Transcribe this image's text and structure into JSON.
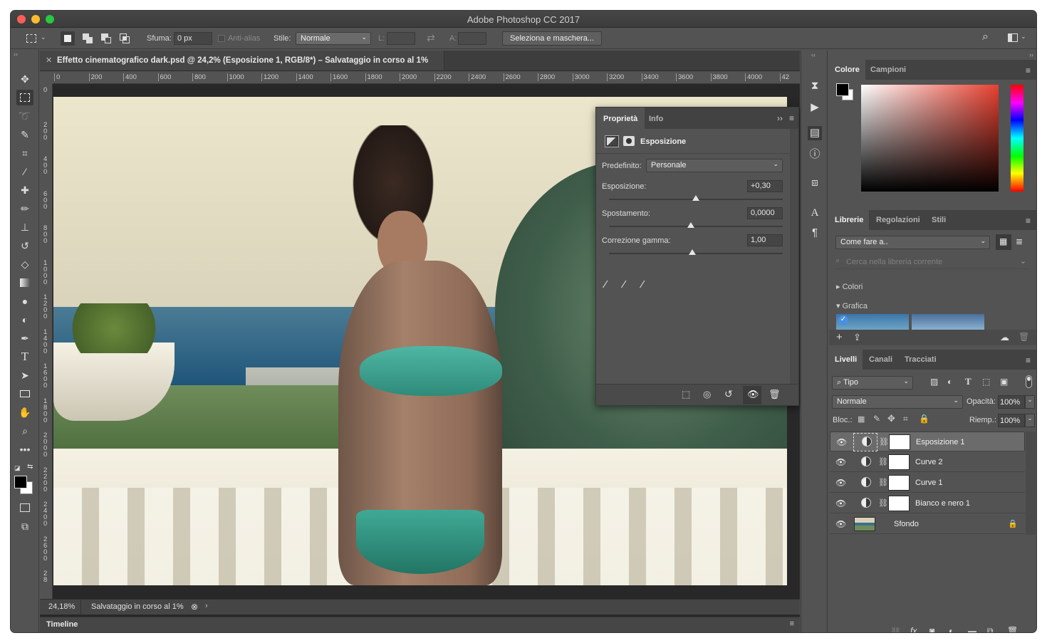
{
  "window": {
    "title": "Adobe Photoshop CC 2017",
    "traffic_colors": [
      "#fc5f57",
      "#fdbc2e",
      "#28c840"
    ]
  },
  "options_bar": {
    "feather_label": "Sfuma:",
    "feather_value": "0 px",
    "antialias_label": "Anti-alias",
    "style_label": "Stile:",
    "style_value": "Normale",
    "width_label": "L:",
    "height_label": "A:",
    "mask_button": "Seleziona e maschera..."
  },
  "document": {
    "tab_title": "Effetto cinematografico dark.psd @ 24,2% (Esposizione 1, RGB/8*) – Salvataggio in corso al 1%",
    "zoom": "24,18%",
    "status_text": "Salvataggio in corso al 1%",
    "ruler_h": [
      "0",
      "200",
      "400",
      "600",
      "800",
      "1000",
      "1200",
      "1400",
      "1600",
      "1800",
      "2000",
      "2200",
      "2400",
      "2600",
      "2800",
      "3000",
      "3200",
      "3400",
      "3600",
      "3800",
      "4000",
      "42"
    ],
    "ruler_v": [
      "0",
      "2 0 0",
      "4 0 0",
      "6 0 0",
      "8 0 0",
      "1 0 0 0",
      "1 2 0 0",
      "1 4 0 0",
      "1 6 0 0",
      "1 8 0 0",
      "2 0 0 0",
      "2 2 0 0",
      "2 4 0 0",
      "2 6 0 0",
      "2 8"
    ],
    "timeline_label": "Timeline"
  },
  "properties": {
    "tabs": [
      "Proprietà",
      "Info"
    ],
    "adjustment_title": "Esposizione",
    "preset_label": "Predefinito:",
    "preset_value": "Personale",
    "sliders": [
      {
        "label": "Esposizione:",
        "value": "+0,30",
        "position": 0.5
      },
      {
        "label": "Spostamento:",
        "value": "0,0000",
        "position": 0.47
      },
      {
        "label": "Correzione gamma:",
        "value": "1,00",
        "position": 0.48
      }
    ]
  },
  "color_panel": {
    "tabs": [
      "Colore",
      "Campioni"
    ],
    "hue_color": "#e84030"
  },
  "libraries_panel": {
    "tabs": [
      "Librerie",
      "Regolazioni",
      "Stili"
    ],
    "library_select": "Come fare a..",
    "search_placeholder": "Cerca nella libreria corrente",
    "section_colors": "Colori",
    "section_graphics": "Grafica"
  },
  "layers_panel": {
    "tabs": [
      "Livelli",
      "Canali",
      "Tracciati"
    ],
    "filter_value": "Tipo",
    "blend_mode": "Normale",
    "opacity_label": "Opacità:",
    "opacity_value": "100%",
    "lock_label": "Bloc.:",
    "fill_label": "Riemp.:",
    "fill_value": "100%",
    "layers": [
      {
        "name": "Esposizione 1",
        "type": "adjustment",
        "selected": true
      },
      {
        "name": "Curve 2",
        "type": "adjustment",
        "selected": false
      },
      {
        "name": "Curve 1",
        "type": "adjustment",
        "selected": false
      },
      {
        "name": "Bianco e nero 1",
        "type": "adjustment",
        "selected": false
      },
      {
        "name": "Sfondo",
        "type": "image",
        "selected": false
      }
    ]
  }
}
